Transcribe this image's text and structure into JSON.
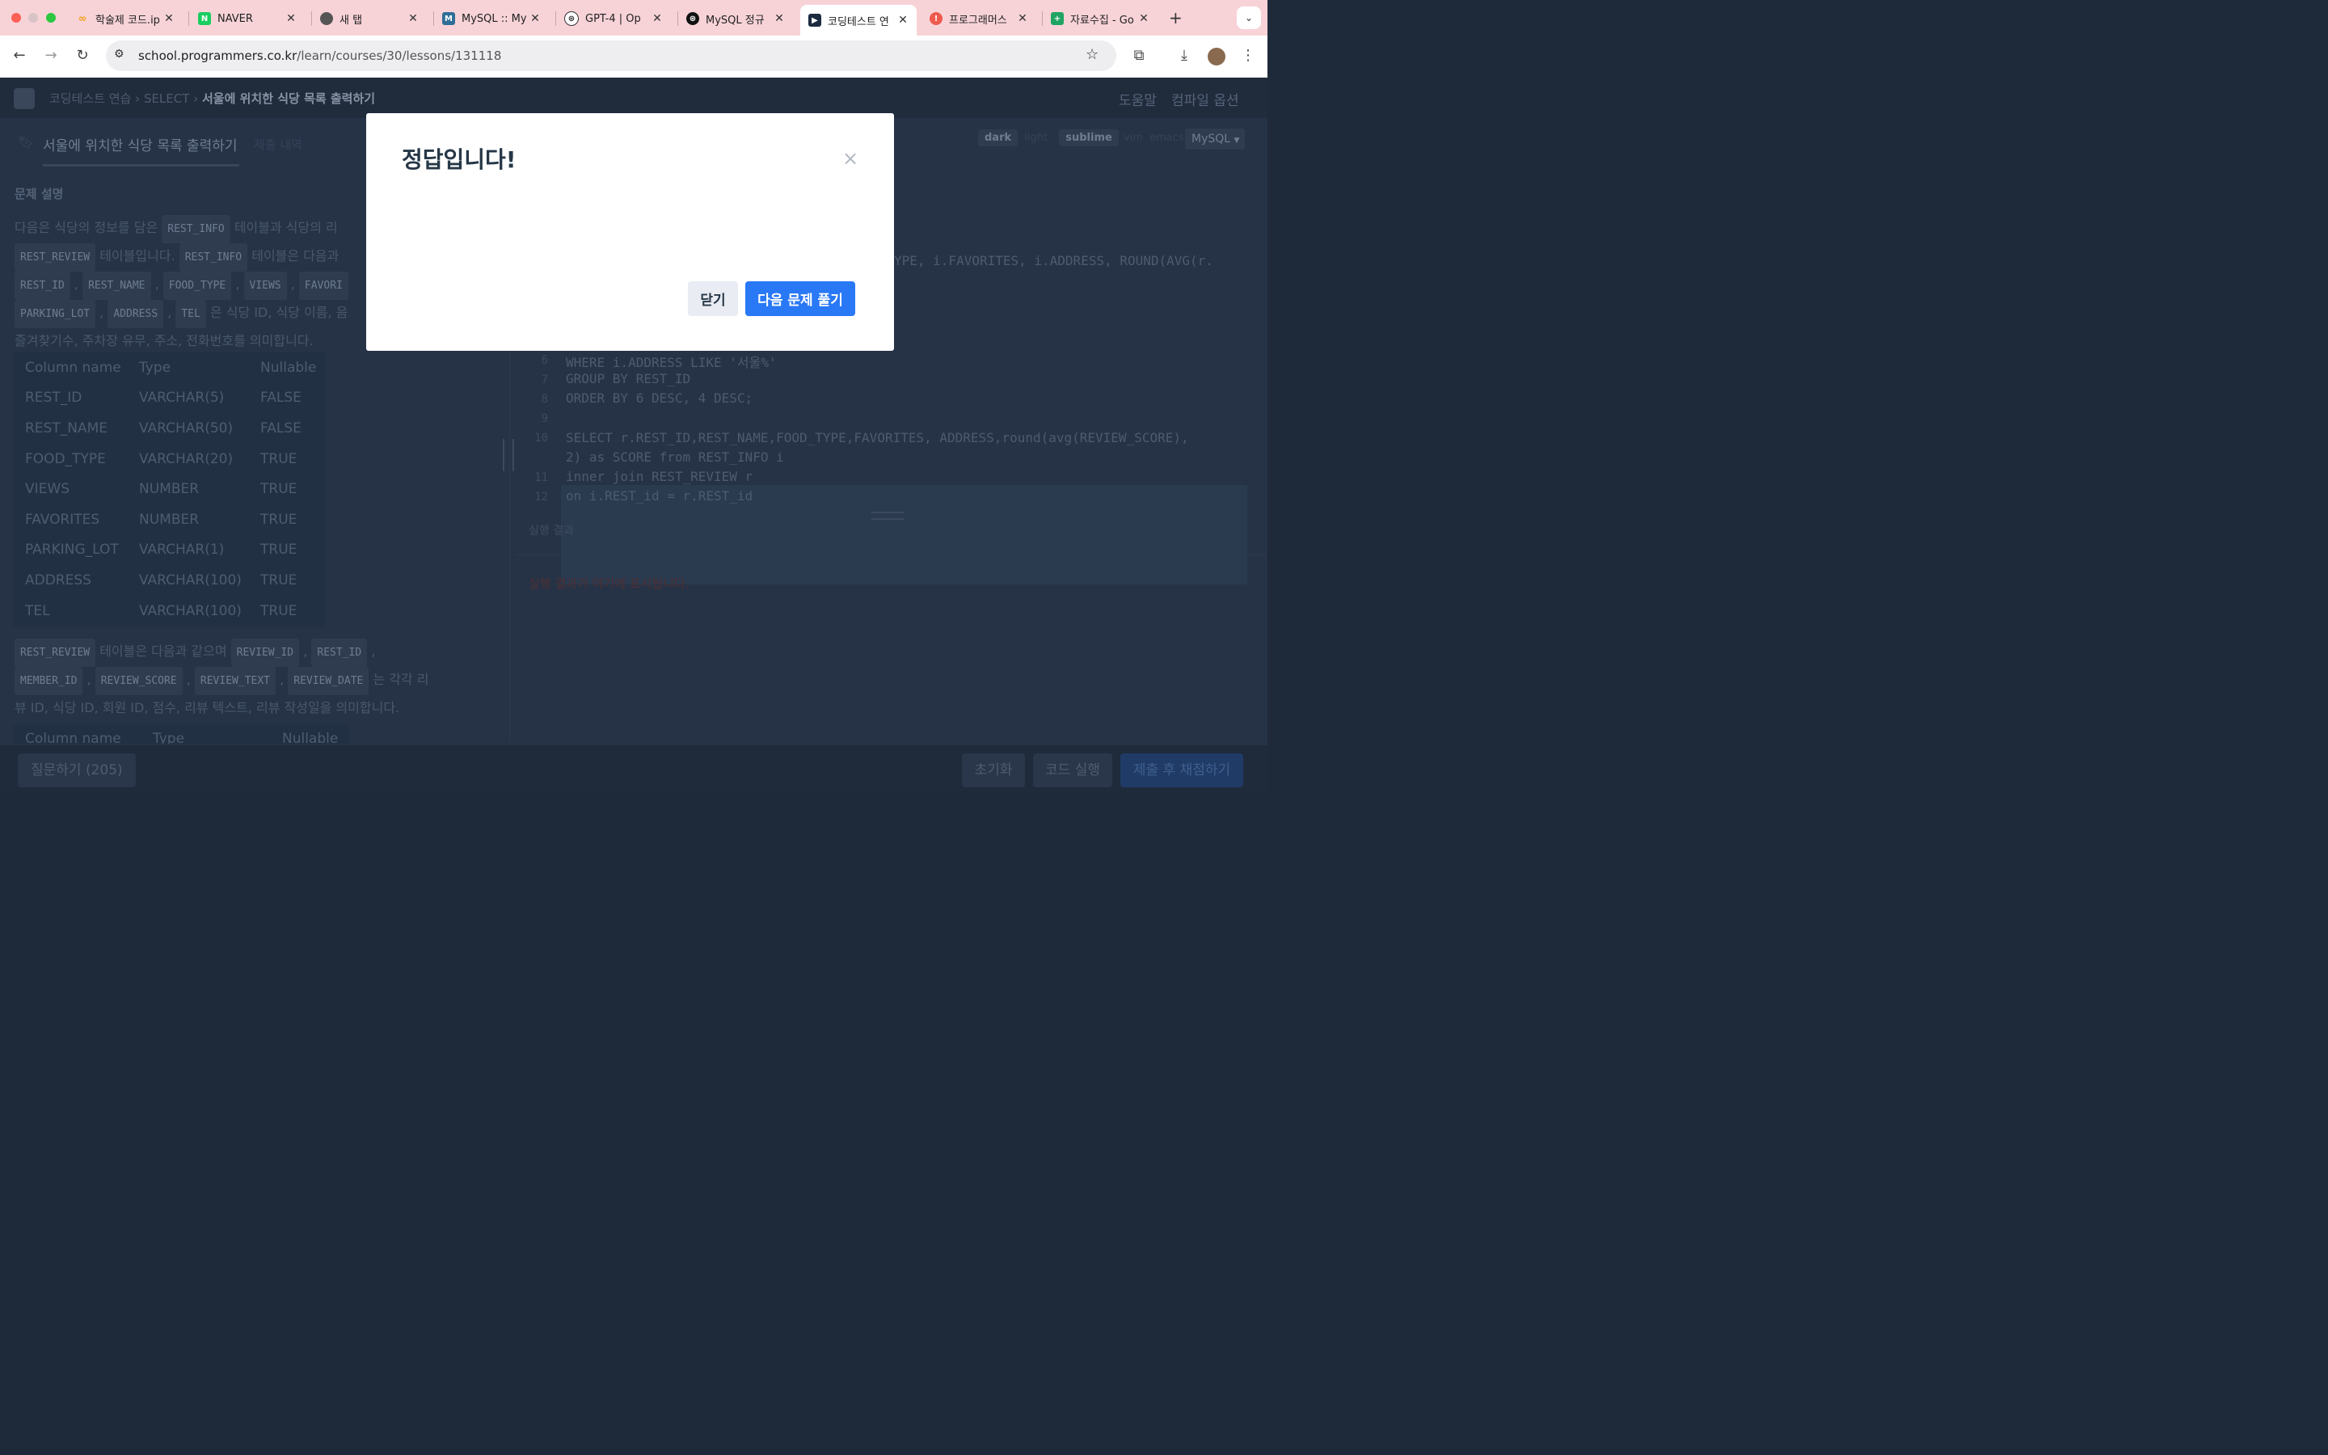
{
  "browser": {
    "tabs": [
      {
        "title": "학술제 코드.ip",
        "icon": "colab-icon",
        "color": "#f4a21a"
      },
      {
        "title": "NAVER",
        "icon": "naver-icon",
        "color": "#19ce60"
      },
      {
        "title": "새 탭",
        "icon": "chrome-icon",
        "color": "#555555"
      },
      {
        "title": "MySQL :: My",
        "icon": "mysql-icon",
        "color": "#2f6f97"
      },
      {
        "title": "GPT-4 | Op",
        "icon": "openai-icon",
        "color": "#333333"
      },
      {
        "title": "MySQL 정규",
        "icon": "openai-icon",
        "color": "#111111"
      },
      {
        "title": "코딩테스트 연",
        "icon": "programmers-icon",
        "color": "#1d2b3f"
      },
      {
        "title": "프로그래머스",
        "icon": "programmers-red-icon",
        "color": "#ee5a4e"
      },
      {
        "title": "자료수집 - Go",
        "icon": "sheets-icon",
        "color": "#1fa463"
      }
    ],
    "url_host": "school.programmers.co.kr",
    "url_path": "/learn/courses/30/lessons/131118"
  },
  "header": {
    "breadcrumb": [
      "코딩테스트 연습",
      "SELECT",
      "서울에 위치한 식당 목록 출력하기"
    ],
    "menu": [
      "도움말",
      "컴파일 옵션"
    ]
  },
  "left": {
    "tabs": [
      "서울에 위치한 식당 목록 출력하기",
      "제출 내역"
    ],
    "section_title": "문제 설명",
    "desc1_a": "다음은 식당의 정보를 담은",
    "desc1_t1": "REST_INFO",
    "desc1_b": "테이블과 식당의 리",
    "desc1_t2": "REST_REVIEW",
    "desc1_c": "테이블입니다.",
    "desc1_t3": "REST_INFO",
    "desc1_d": "테이블은 다음과",
    "desc1_cols": [
      "REST_ID",
      "REST_NAME",
      "FOOD_TYPE",
      "VIEWS",
      "FAVORI"
    ],
    "desc1_cols2": [
      "PARKING_LOT",
      "ADDRESS",
      "TEL"
    ],
    "desc1_e": "은 식당 ID, 식당 이름, 음",
    "desc1_f": "즐겨찾기수, 주차장 유무, 주소, 전화번호를 의미합니다.",
    "schema_headers": [
      "Column name",
      "Type",
      "Nullable"
    ],
    "schema_rows": [
      [
        "REST_ID",
        "VARCHAR(5)",
        "FALSE"
      ],
      [
        "REST_NAME",
        "VARCHAR(50)",
        "FALSE"
      ],
      [
        "FOOD_TYPE",
        "VARCHAR(20)",
        "TRUE"
      ],
      [
        "VIEWS",
        "NUMBER",
        "TRUE"
      ],
      [
        "FAVORITES",
        "NUMBER",
        "TRUE"
      ],
      [
        "PARKING_LOT",
        "VARCHAR(1)",
        "TRUE"
      ],
      [
        "ADDRESS",
        "VARCHAR(100)",
        "TRUE"
      ],
      [
        "TEL",
        "VARCHAR(100)",
        "TRUE"
      ]
    ],
    "desc2_t1": "REST_REVIEW",
    "desc2_a": "테이블은 다음과 같으며",
    "desc2_cols": [
      "REVIEW_ID",
      "REST_ID"
    ],
    "desc2_cols2": [
      "MEMBER_ID",
      "REVIEW_SCORE",
      "REVIEW_TEXT",
      "REVIEW_DATE"
    ],
    "desc2_b": "는 각각 리",
    "desc2_c": "뷰 ID, 식당 ID, 회원 ID, 점수, 리뷰 텍스트, 리뷰 작성일을 의미합니다.",
    "schema2_headers": [
      "Column name",
      "Type",
      "Nullable"
    ]
  },
  "editor": {
    "theme_options": [
      "dark",
      "light",
      "sublime",
      "vim",
      "emacs"
    ],
    "language": "MySQL",
    "line1_tail": "YPE, i.FAVORITES, i.ADDRESS, ROUND(AVG(r.",
    "lines": [
      {
        "n": "6",
        "text": "WHERE i.ADDRESS LIKE '서울%'"
      },
      {
        "n": "7",
        "text": "GROUP BY REST_ID"
      },
      {
        "n": "8",
        "text": "ORDER BY 6 DESC, 4 DESC;"
      },
      {
        "n": "9",
        "text": ""
      },
      {
        "n": "10",
        "text": "SELECT r.REST_ID,REST_NAME,FOOD_TYPE,FAVORITES, ADDRESS,round(avg(REVIEW_SCORE),"
      },
      {
        "n": "",
        "text": "2) as SCORE from REST_INFO i"
      },
      {
        "n": "11",
        "text": "inner join REST_REVIEW r"
      },
      {
        "n": "12",
        "text": "on i.REST_id = r.REST_id"
      }
    ],
    "result_label": "실행 결과",
    "result_text": "실행 결과가 여기에 표시됩니다."
  },
  "footer": {
    "ask": "질문하기 (205)",
    "reset": "초기화",
    "run": "코드 실행",
    "submit": "제출 후 채점하기"
  },
  "modal": {
    "title": "정답입니다!",
    "close_symbol": "×",
    "close_label": "닫기",
    "next_label": "다음 문제 풀기"
  }
}
